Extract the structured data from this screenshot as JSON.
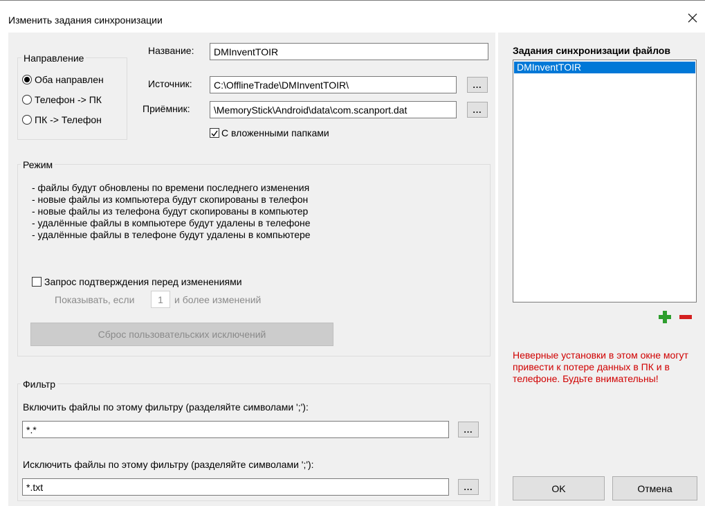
{
  "window": {
    "title": "Изменить задания синхронизации"
  },
  "direction": {
    "label": "Направление",
    "options": [
      {
        "label": "Оба направлен",
        "selected": true
      },
      {
        "label": "Телефон -> ПК",
        "selected": false
      },
      {
        "label": "ПК -> Телефон",
        "selected": false
      }
    ]
  },
  "fields": {
    "name_label": "Название:",
    "name_value": "DMInventTOIR",
    "source_label": "Источник:",
    "source_value": "C:\\OfflineTrade\\DMInventTOIR\\",
    "target_label": "Приёмник:",
    "target_value": "\\MemoryStick\\Android\\data\\com.scanport.dat",
    "browse_label": "...",
    "subfolders_label": "С вложенными папками",
    "subfolders_checked": true
  },
  "mode": {
    "label": "Режим",
    "lines": [
      "- файлы будут обновлены по времени последнего изменения",
      "- новые файлы из компьютера будут скопированы в телефон",
      "- новые файлы из телефона будут скопированы в компьютер",
      "- удалённые файлы в компьютере будут удалены в телефоне",
      "- удалённые файлы в телефоне будут удалены в компьютере"
    ],
    "confirm_label": "Запрос подтверждения перед изменениями",
    "confirm_checked": false,
    "show_if_label": "Показывать, если",
    "show_if_value": "1",
    "more_changes_label": "и более изменений",
    "reset_label": "Сброс пользовательских исключений"
  },
  "filter": {
    "label": "Фильтр",
    "include_label": "Включить файлы по этому фильтру (разделяйте символами ';'):",
    "include_value": "*.*",
    "exclude_label": "Исключить файлы по этому фильтру (разделяйте символами ';'):",
    "exclude_value": "*.txt"
  },
  "tasks": {
    "heading": "Задания синхронизации файлов",
    "items": [
      "DMInventTOIR"
    ],
    "add_icon": "plus-icon",
    "remove_icon": "minus-icon"
  },
  "warning": "Неверные установки в этом окне могут привести к потере данных в ПК и в телефоне. Будьте внимательны!",
  "buttons": {
    "ok": "OK",
    "cancel": "Отмена"
  },
  "colors": {
    "selection": "#0078d7",
    "warning": "#d00000",
    "add": "#2e9e2e",
    "remove": "#d42020"
  }
}
